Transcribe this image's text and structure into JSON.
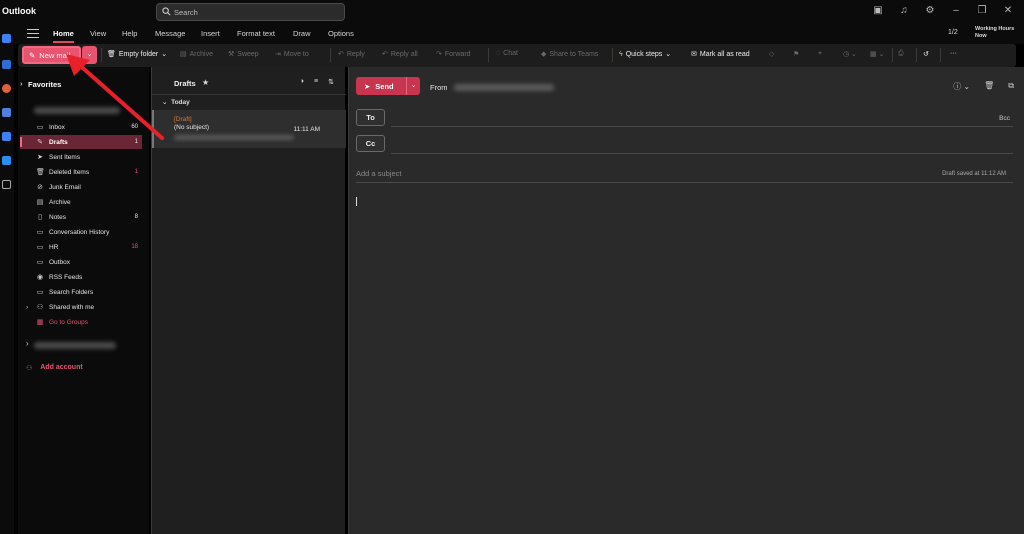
{
  "app": {
    "title": "Outlook"
  },
  "search": {
    "placeholder": "Search"
  },
  "tabs": [
    "Home",
    "View",
    "Help",
    "Message",
    "Insert",
    "Format text",
    "Draw",
    "Options"
  ],
  "header": {
    "pager": "1/2",
    "working_hours_line1": "Working Hours",
    "working_hours_line2": "Now"
  },
  "ribbon": {
    "new_mail": "New mail",
    "empty_folder": "Empty folder",
    "archive": "Archive",
    "sweep": "Sweep",
    "move_to": "Move to",
    "reply": "Reply",
    "reply_all": "Reply all",
    "forward": "Forward",
    "chat": "Chat",
    "share_to_teams": "Share to Teams",
    "quick_steps": "Quick steps",
    "mark_all_as_read": "Mark all as read",
    "more": "···"
  },
  "folders": {
    "favorites": "Favorites",
    "items": [
      {
        "label": "Inbox",
        "count": "60",
        "icon": "inbox-icon",
        "glyph": "▭"
      },
      {
        "label": "Drafts",
        "count": "1",
        "icon": "pencil-icon",
        "glyph": "✎"
      },
      {
        "label": "Sent Items",
        "count": "",
        "icon": "send-icon",
        "glyph": "➤"
      },
      {
        "label": "Deleted Items",
        "count": "1",
        "icon": "trash-icon",
        "glyph": "🗑"
      },
      {
        "label": "Junk Email",
        "count": "",
        "icon": "junk-icon",
        "glyph": "⊘"
      },
      {
        "label": "Archive",
        "count": "",
        "icon": "archive-icon",
        "glyph": "▤"
      },
      {
        "label": "Notes",
        "count": "8",
        "icon": "note-icon",
        "glyph": "▯"
      },
      {
        "label": "Conversation History",
        "count": "",
        "icon": "folder-icon",
        "glyph": "▭"
      },
      {
        "label": "HR",
        "count": "18",
        "icon": "folder-icon",
        "glyph": "▭"
      },
      {
        "label": "Outbox",
        "count": "",
        "icon": "outbox-icon",
        "glyph": "▭"
      },
      {
        "label": "RSS Feeds",
        "count": "",
        "icon": "rss-icon",
        "glyph": "◉"
      },
      {
        "label": "Search Folders",
        "count": "",
        "icon": "search-folder-icon",
        "glyph": "▭"
      },
      {
        "label": "Shared with me",
        "count": "",
        "icon": "shared-icon",
        "glyph": "⚇"
      },
      {
        "label": "Go to Groups",
        "count": "",
        "icon": "groups-icon",
        "glyph": "▦"
      }
    ],
    "add_account": "Add account"
  },
  "message_list": {
    "title": "Drafts",
    "group": "Today",
    "messages": [
      {
        "tag": "[Draft]",
        "subject": "(No subject)",
        "time": "11:11 AM"
      }
    ]
  },
  "compose": {
    "send": "Send",
    "from_label": "From",
    "to": "To",
    "cc": "Cc",
    "bcc": "Bcc",
    "subject_placeholder": "Add a subject",
    "saved_status": "Draft saved at 11:12 AM"
  },
  "colors": {
    "accent": "#e8536f",
    "selected_folder": "#6a2634",
    "send": "#c8354f",
    "draft_tag": "#d17a3a"
  }
}
